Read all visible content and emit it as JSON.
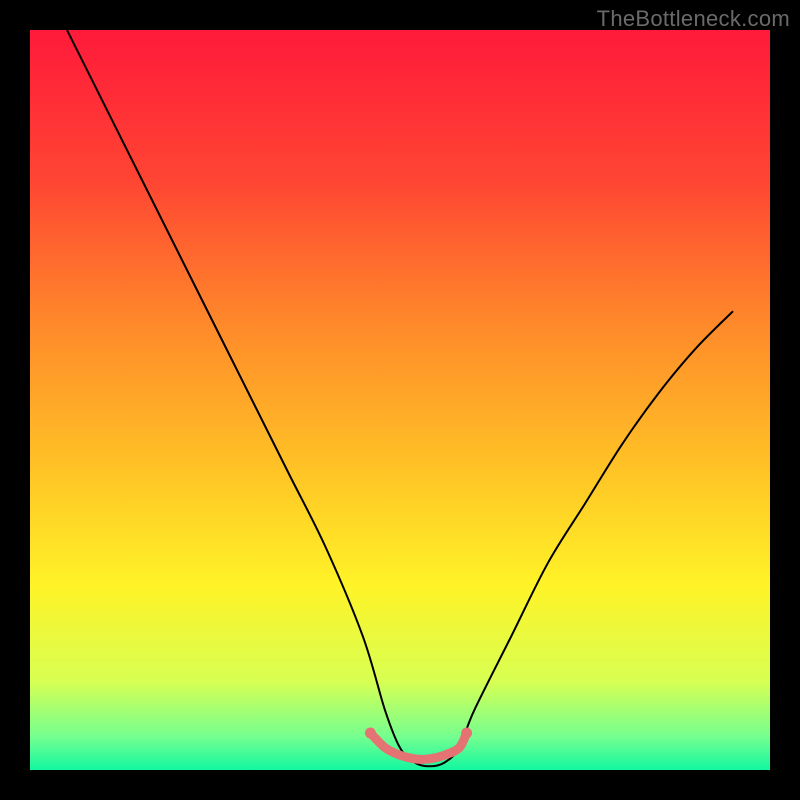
{
  "watermark": "TheBottleneck.com",
  "chart_data": {
    "type": "area",
    "title": "",
    "xlabel": "",
    "ylabel": "",
    "xlim": [
      0,
      100
    ],
    "ylim": [
      0,
      100
    ],
    "grid": false,
    "legend": false,
    "axis_visible": false,
    "gradient_stops": [
      {
        "offset": 0.0,
        "color": "#ff1a3a"
      },
      {
        "offset": 0.2,
        "color": "#ff4433"
      },
      {
        "offset": 0.4,
        "color": "#ff8a2a"
      },
      {
        "offset": 0.58,
        "color": "#ffbf26"
      },
      {
        "offset": 0.75,
        "color": "#fff327"
      },
      {
        "offset": 0.88,
        "color": "#d8ff52"
      },
      {
        "offset": 0.955,
        "color": "#74ff8f"
      },
      {
        "offset": 1.0,
        "color": "#13f7a0"
      }
    ],
    "curve": {
      "description": "Percent bottleneck vs configuration (V-shaped, min near x≈53)",
      "x": [
        5,
        10,
        15,
        20,
        25,
        30,
        35,
        40,
        45,
        48,
        50,
        52,
        54,
        56,
        58,
        60,
        65,
        70,
        75,
        80,
        85,
        90,
        95
      ],
      "y": [
        100,
        90,
        80,
        70,
        60,
        50,
        40,
        30,
        18,
        8,
        3,
        1,
        0.5,
        1,
        3,
        8,
        18,
        28,
        36,
        44,
        51,
        57,
        62
      ]
    },
    "marker_segment": {
      "description": "Highlighted optimal range near curve bottom",
      "x": [
        46,
        48,
        50,
        52,
        54,
        56,
        58,
        59
      ],
      "y": [
        5,
        3,
        2,
        1.5,
        1.5,
        2,
        3,
        5
      ],
      "color": "#e57373",
      "endpoint_radius": 5.5,
      "stroke_width": 9
    }
  }
}
